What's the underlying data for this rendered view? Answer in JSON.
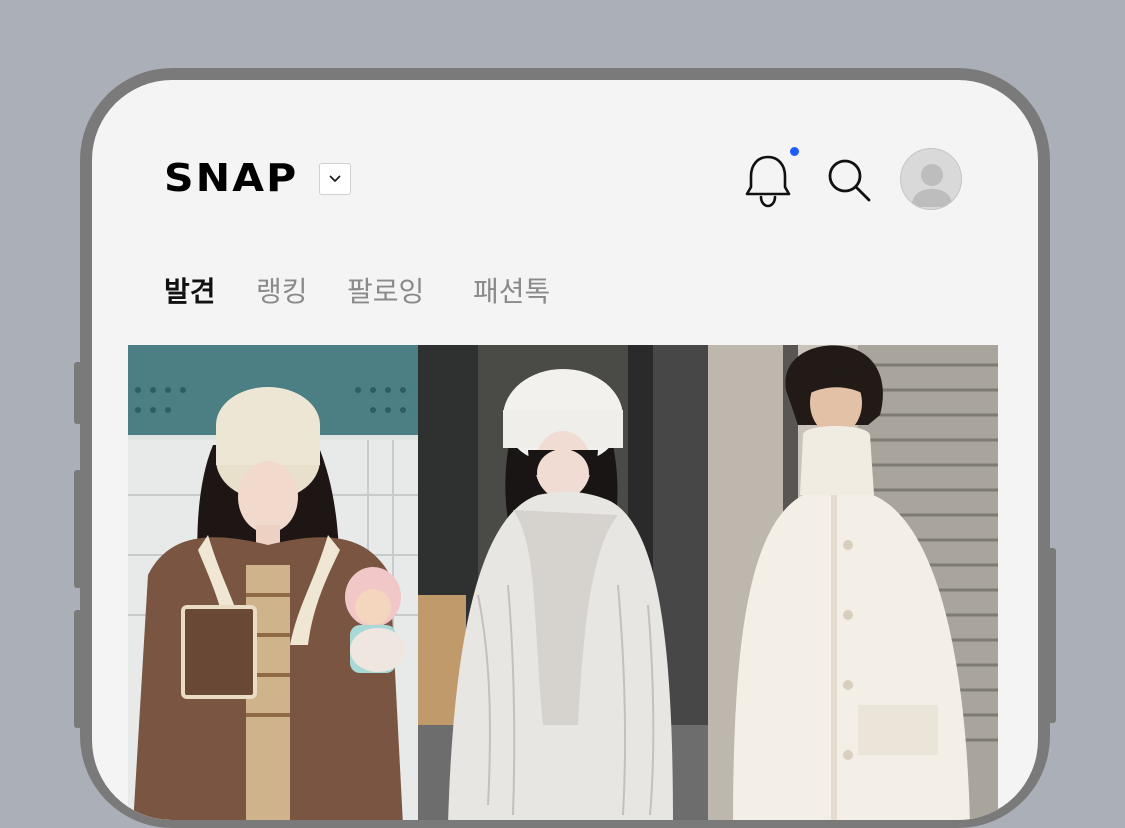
{
  "header": {
    "logo": "SNAP",
    "has_notification": true
  },
  "icons": {
    "dropdown": "chevron-down-icon",
    "notifications": "bell-icon",
    "search": "search-icon",
    "profile": "user-avatar-icon"
  },
  "tabs": [
    {
      "label": "발견",
      "active": true
    },
    {
      "label": "랭킹",
      "active": false
    },
    {
      "label": "팔로잉",
      "active": false
    },
    {
      "label": "패션톡",
      "active": false
    }
  ],
  "feed": {
    "items": [
      {
        "description": "beige fleece bucket hat, brown shearling jacket, plush doll"
      },
      {
        "description": "white fur bucket hat, white faux fur coat"
      },
      {
        "description": "cream high-neck wool coat"
      }
    ]
  },
  "colors": {
    "notification_dot": "#1f5bff",
    "active_tab": "#111111",
    "inactive_tab": "#8a8a8a"
  }
}
